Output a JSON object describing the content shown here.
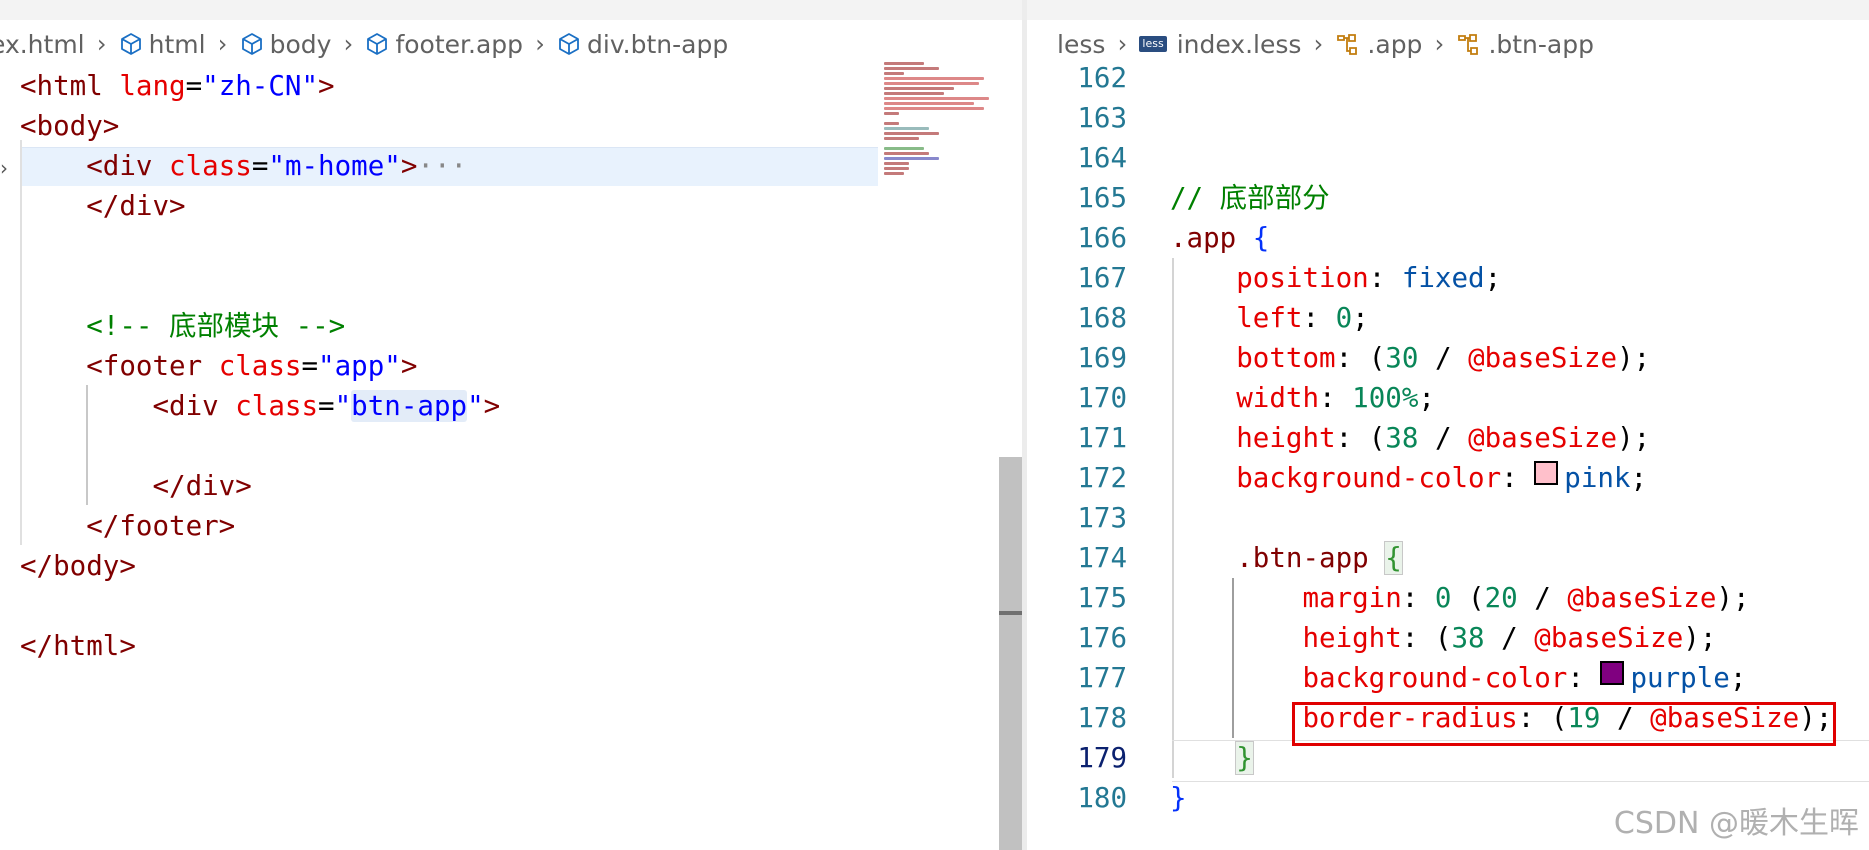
{
  "left_pane": {
    "breadcrumb": [
      "ex.html",
      "html",
      "body",
      "footer.app",
      "div.btn-app"
    ],
    "code": {
      "l1_open": "<html ",
      "l1_attr": "lang",
      "l1_eq": "=",
      "l1_val": "\"zh-CN\"",
      "l1_close": ">",
      "l2": "<body>",
      "l3_open": "<div ",
      "l3_attr": "class",
      "l3_eq": "=",
      "l3_val": "\"m-home\"",
      "l3_close": ">",
      "l3_ellipsis": "···",
      "l4": "</div>",
      "l7": "<!-- 底部模块 -->",
      "l8_open": "<footer ",
      "l8_attr": "class",
      "l8_eq": "=",
      "l8_val": "\"app\"",
      "l8_close": ">",
      "l9_open": "<div ",
      "l9_attr": "class",
      "l9_eq": "=",
      "l9_q1": "\"",
      "l9_val": "btn-app",
      "l9_q2": "\"",
      "l9_close": ">",
      "l11": "</div>",
      "l12": "</footer>",
      "l13": "</body>",
      "l15": "</html>"
    }
  },
  "right_pane": {
    "breadcrumb": [
      "less",
      "index.less",
      ".app",
      ".btn-app"
    ],
    "breadcrumb_badge": "less",
    "line_numbers": [
      "162",
      "163",
      "164",
      "165",
      "166",
      "167",
      "168",
      "169",
      "170",
      "171",
      "172",
      "173",
      "174",
      "175",
      "176",
      "177",
      "178",
      "179",
      "180"
    ],
    "code": {
      "comment": "// 底部部分",
      "app_sel": ".app",
      "brace_open": "{",
      "brace_close": "}",
      "prop_position": "position",
      "val_position": "fixed",
      "prop_left": "left",
      "val_left": "0",
      "prop_bottom": "bottom",
      "val_bottom_num": "30",
      "var_base": "@baseSize",
      "prop_width": "width",
      "val_width": "100%",
      "prop_height": "height",
      "val_height_num": "38",
      "prop_bg": "background-color",
      "val_bg_pink": "pink",
      "btn_sel": ".btn-app",
      "prop_margin": "margin",
      "val_margin_zero": "0",
      "val_margin_num": "20",
      "val_bg_purple": "purple",
      "prop_radius": "border-radius",
      "val_radius_num": "19",
      "colon": ": ",
      "semi": ";",
      "open_paren": "(",
      "close_paren": ")",
      "slash": " / "
    },
    "swatch_colors": {
      "pink": "#ffc0cb",
      "purple": "#800080"
    }
  },
  "watermark": "CSDN @暖木生晖",
  "theme": {
    "tag": "#800000",
    "attr": "#e50000",
    "string": "#0000ff",
    "comment": "#008000",
    "number": "#098658",
    "keyword": "#0451a5",
    "line_number": "#237893",
    "highlight_box": "#e00000"
  }
}
